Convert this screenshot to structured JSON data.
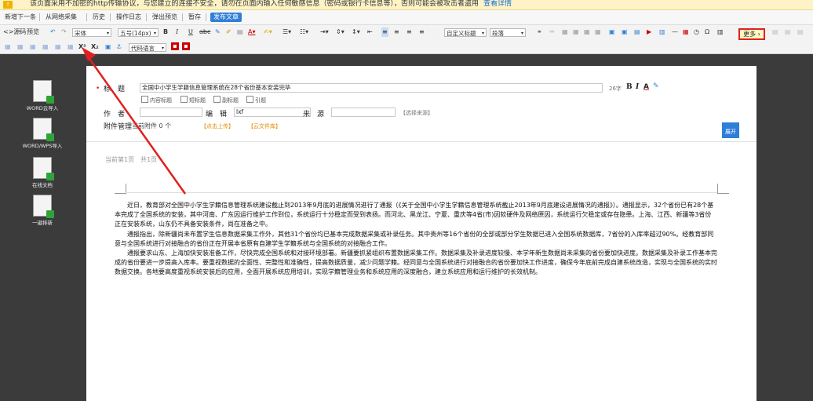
{
  "warning": {
    "text": "该页面采用不加密的http传输协议，与您建立的连接不安全，请勿在页面内输入任何敏感信息（密码或银行卡信息等），否则可能会被攻击者盗用",
    "link": "查看详情"
  },
  "actions": {
    "new_next": "新增下一条",
    "collect": "从网络采集",
    "history": "历史",
    "log": "操作日志",
    "popup_preview": "弹出预览",
    "save": "暂存",
    "publish": "发布文章"
  },
  "toolbar": {
    "source": "源码",
    "preview": "预览",
    "font": "宋体",
    "font_size": "五号(14px)",
    "custom_title": "自定义标题",
    "paragraph": "段落",
    "more": "更多",
    "code_lang": "代码语言"
  },
  "left_panel": [
    {
      "label": "WORD云导入"
    },
    {
      "label": "WORD/WPS导入"
    },
    {
      "label": "在线文档"
    },
    {
      "label": "一键排新"
    }
  ],
  "form": {
    "title_label": "标　题",
    "title_value": "全国中小学生学籍信息管理系统在28个省份基本安装完毕",
    "char_count": "26字",
    "options": [
      "内容标题",
      "短标题",
      "副标题",
      "引题"
    ],
    "author_label": "作　者",
    "editor_label": "编　辑",
    "editor_value": "lxf",
    "source_label": "来　源",
    "source_select": "【选择来源】",
    "attach_label": "附件管理",
    "attach_count": "当前附件 0 个",
    "upload": "【点击上传】",
    "cloud_lib": "【云文件库】",
    "expand": "展开"
  },
  "editor": {
    "page_label": "当前第1页　共1页",
    "paragraphs": [
      "近日，教育部对全国中小学生学籍信息管理系统建设截止到2013年9月底的进展情况进行了通报（《关于全国中小学生学籍信息管理系统截止2013年9月底建设进展情况的通报》）。通报显示，32个省份已有28个基本完成了全国系统的安装，其中河南、广东因运行维护工作到位，系统运行十分稳定而受到表扬。而河北、黑龙江、宁夏、重庆等4省(市)因软硬件及网络原因，系统运行欠稳定或存在隐患。上海、江西、新疆等3省份正在安装系统，山东仍不具备安装条件，尚在准备之中。",
      "通报指出，除新疆尚未布置学生信息数据采集工作外，其他31个省份均已基本完成数据采集或补录任务。其中贵州等16个省份的全部或部分学生数据已进入全国系统数据库，7省份的入库率超过90%。经教育部同意与全国系统进行对接融合的省份正在开展本省原有自建学生学籍系统与全国系统的对接融合工作。",
      "通报要求山东、上海加快安装准备工作，尽快完成全国系统和对接环境部署。新疆要抓紧组织布置数据采集工作。数据采集及补录进度较慢、本学年新生数据尚未采集的省份要加快进度。数据采集及补录工作基本完成的省份要进一步提高入库率。要重视数据的全面性、完整性和准确性，提高数据质量，减少问题学籍。经同意与全国系统进行对接融合的省份要加快工作进度，确保今年底前完成自建系统改造，实现与全国系统的实时数据交换。各地要高度重视系统安装后的应用，全面开展系统应用培训，实现学籍管理业务和系统应用的深度融合，建立系统应用和运行维护的长效机制。"
    ]
  },
  "colors": {
    "accent": "#2f7ed8",
    "highlight_border": "#e02020",
    "arrow": "#e02020"
  }
}
